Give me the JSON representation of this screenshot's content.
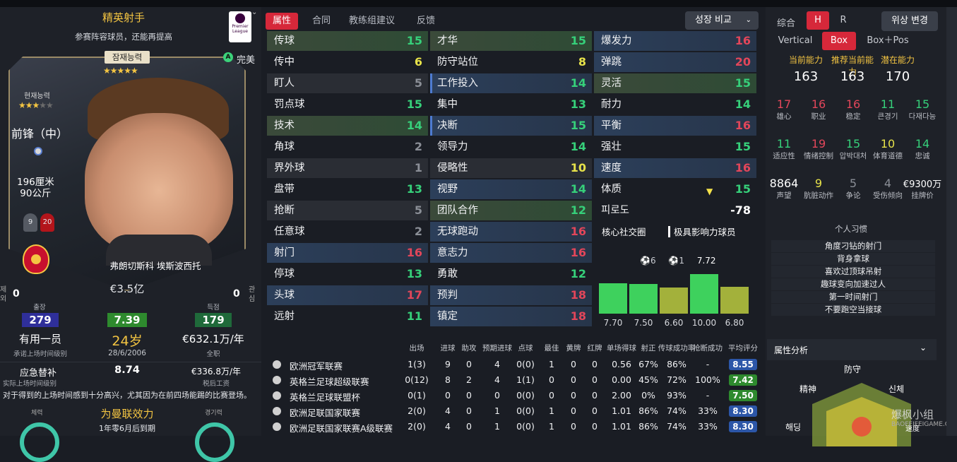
{
  "profile": {
    "role_title": "精英射手",
    "role_subtitle": "参赛阵容球员，还能再提高",
    "league_logo_text": "Premier League",
    "potential_label": "잠재능력",
    "potential_stars": "★★★★★",
    "perfect_icon": "A",
    "perfect_label": "完美",
    "current_label": "현재능력",
    "current_stars": "★★★",
    "current_stars_dim": "★★",
    "position": "前锋（中）",
    "height": "196厘米",
    "weight": "90公斤",
    "squad_number_left": "9",
    "squad_number_right": "20",
    "name": "弗朗切斯科 埃斯波西托",
    "value": "€3.5亿",
    "left_zero": "0",
    "left_zero_label": "제\n외",
    "right_zero": "0",
    "right_zero_label": "관\n심",
    "apps_label": "출장",
    "apps": "279",
    "rating_label": "",
    "rating": "7.39",
    "goals_label": "득점",
    "goals": "179",
    "status": "有用一员",
    "status_sub": "承诺上场时间级别",
    "age": "24岁",
    "dob": "28/6/2006",
    "wage": "€632.1万/年",
    "wage_sub": "全职",
    "squad_role": "应急替补",
    "squad_role_sub": "实际上场时间级别",
    "avg_rating": "8.74",
    "avg_rating_sub": "平均评分",
    "bonus": "€336.8万/年",
    "bonus_sub": "税后工资",
    "note": "对于得到的上场时间感到十分高兴，尤其因为在前四场能踢的比赛登场。",
    "condition_label": "체력",
    "contract_title": "为曼联效力",
    "contract_sub": "1年零6月后到期",
    "sharpness_label": "경기력"
  },
  "tabs": [
    {
      "label": "属性",
      "active": true
    },
    {
      "label": "合同"
    },
    {
      "label": "教练组建议"
    },
    {
      "label": "反馈"
    }
  ],
  "compare": {
    "label": "성장 비교",
    "chevron": "⌄"
  },
  "attributes": {
    "col1": [
      {
        "name": "传球",
        "value": "15",
        "cls": "v-green"
      },
      {
        "name": "传中",
        "value": "6",
        "cls": "v-yellow"
      },
      {
        "name": "盯人",
        "value": "5",
        "cls": "v-gray"
      },
      {
        "name": "罚点球",
        "value": "15",
        "cls": "v-green"
      },
      {
        "name": "技术",
        "value": "14",
        "cls": "v-green"
      },
      {
        "name": "角球",
        "value": "2",
        "cls": "v-gray"
      },
      {
        "name": "界外球",
        "value": "1",
        "cls": "v-gray"
      },
      {
        "name": "盘带",
        "value": "13",
        "cls": "v-green"
      },
      {
        "name": "抢断",
        "value": "5",
        "cls": "v-gray"
      },
      {
        "name": "任意球",
        "value": "2",
        "cls": "v-gray"
      },
      {
        "name": "射门",
        "value": "16",
        "cls": "v-red"
      },
      {
        "name": "停球",
        "value": "13",
        "cls": "v-green"
      },
      {
        "name": "头球",
        "value": "17",
        "cls": "v-red"
      },
      {
        "name": "远射",
        "value": "11",
        "cls": "v-green"
      }
    ],
    "col2": [
      {
        "name": "才华",
        "value": "15",
        "cls": "v-green"
      },
      {
        "name": "防守站位",
        "value": "8",
        "cls": "v-yellow"
      },
      {
        "name": "工作投入",
        "value": "14",
        "cls": "v-green"
      },
      {
        "name": "集中",
        "value": "13",
        "cls": "v-green"
      },
      {
        "name": "决断",
        "value": "15",
        "cls": "v-green"
      },
      {
        "name": "领导力",
        "value": "14",
        "cls": "v-green"
      },
      {
        "name": "侵略性",
        "value": "10",
        "cls": "v-yellow"
      },
      {
        "name": "视野",
        "value": "14",
        "cls": "v-green"
      },
      {
        "name": "团队合作",
        "value": "12",
        "cls": "v-green"
      },
      {
        "name": "无球跑动",
        "value": "16",
        "cls": "v-red"
      },
      {
        "name": "意志力",
        "value": "16",
        "cls": "v-red"
      },
      {
        "name": "勇敢",
        "value": "12",
        "cls": "v-green"
      },
      {
        "name": "预判",
        "value": "18",
        "cls": "v-red"
      },
      {
        "name": "镇定",
        "value": "18",
        "cls": "v-red"
      }
    ],
    "col3": [
      {
        "name": "爆发力",
        "value": "16",
        "cls": "v-red"
      },
      {
        "name": "弹跳",
        "value": "20",
        "cls": "v-red"
      },
      {
        "name": "灵活",
        "value": "15",
        "cls": "v-green"
      },
      {
        "name": "耐力",
        "value": "14",
        "cls": "v-green"
      },
      {
        "name": "平衡",
        "value": "16",
        "cls": "v-red"
      },
      {
        "name": "强壮",
        "value": "15",
        "cls": "v-green"
      },
      {
        "name": "速度",
        "value": "16",
        "cls": "v-red"
      },
      {
        "name": "体质",
        "value": "15",
        "cls": "v-green"
      },
      {
        "name": "피로도",
        "value": "-78",
        "cls": "v-white"
      }
    ],
    "decline_icon": "▼",
    "hub_label": "核心社交圈",
    "hub2_label": "极具影响力球员"
  },
  "form_chart": {
    "top_left": "6",
    "top_mid": "1",
    "top_value": "7.72"
  },
  "chart_data": {
    "type": "bar",
    "categories": [
      "1",
      "2",
      "3",
      "4",
      "5"
    ],
    "values": [
      7.7,
      7.5,
      6.6,
      10.0,
      6.8
    ],
    "value_labels": [
      "7.70",
      "7.50",
      "6.60",
      "10.00",
      "6.80"
    ],
    "colors": [
      "#3ed15d",
      "#3ed15d",
      "#a3b13b",
      "#3ed15d",
      "#a3b13b"
    ],
    "ylim": [
      0,
      10
    ]
  },
  "stats": {
    "headers": [
      "出场",
      "进球",
      "助攻",
      "预期进球",
      "点球",
      "最佳",
      "黄牌",
      "红牌",
      "单场得球",
      "射正",
      "传球成功率",
      "抢断成功",
      "平均评分"
    ],
    "rows": [
      {
        "comp": "欧洲冠军联赛",
        "vals": [
          "1(3)",
          "9",
          "0",
          "4",
          "0(0)",
          "1",
          "0",
          "0",
          "0.56",
          "67%",
          "86%",
          "-"
        ],
        "rating": "8.55",
        "rc": "#2c56a8"
      },
      {
        "comp": "英格兰足球超级联赛",
        "vals": [
          "0(12)",
          "8",
          "2",
          "4",
          "1(1)",
          "0",
          "0",
          "0",
          "0.00",
          "45%",
          "72%",
          "100%"
        ],
        "rating": "7.42",
        "rc": "#2e8a2e"
      },
      {
        "comp": "英格兰足球联盟杯",
        "vals": [
          "0(1)",
          "0",
          "0",
          "0",
          "0(0)",
          "0",
          "0",
          "0",
          "2.00",
          "0%",
          "93%",
          "-"
        ],
        "rating": "7.50",
        "rc": "#2e8a2e"
      },
      {
        "comp": "欧洲足联国家联赛",
        "vals": [
          "2(0)",
          "4",
          "0",
          "1",
          "0(0)",
          "1",
          "0",
          "0",
          "1.01",
          "86%",
          "74%",
          "33%"
        ],
        "rating": "8.30",
        "rc": "#2c56a8"
      },
      {
        "comp": "欧洲足联国家联赛A级联赛",
        "vals": [
          "2(0)",
          "4",
          "0",
          "1",
          "0(0)",
          "1",
          "0",
          "0",
          "1.01",
          "86%",
          "74%",
          "33%"
        ],
        "rating": "8.30",
        "rc": "#2c56a8"
      }
    ]
  },
  "right": {
    "overall_label": "综合",
    "h": "H",
    "r": "R",
    "change_label": "위상 변경",
    "vertical": "Vertical",
    "box": "Box",
    "boxpos": "Box＋Pos",
    "ability_headers": [
      "当前能力",
      "推荐当前能力",
      "潜在能力"
    ],
    "ability_values": [
      "163",
      "163",
      "170"
    ],
    "personal": [
      {
        "n": "17",
        "l": "雄心",
        "c": "#e2465a"
      },
      {
        "n": "16",
        "l": "职业",
        "c": "#e2465a"
      },
      {
        "n": "16",
        "l": "稳定",
        "c": "#e2465a"
      },
      {
        "n": "11",
        "l": "큰경기",
        "c": "#36d07a"
      },
      {
        "n": "15",
        "l": "다재다능",
        "c": "#36d07a"
      },
      {
        "n": "11",
        "l": "适应性",
        "c": "#36d07a"
      },
      {
        "n": "19",
        "l": "情绪控制",
        "c": "#e2465a"
      },
      {
        "n": "15",
        "l": "압박대처",
        "c": "#36d07a"
      },
      {
        "n": "10",
        "l": "体育道德",
        "c": "#e7e24a"
      },
      {
        "n": "14",
        "l": "忠诚",
        "c": "#36d07a"
      },
      {
        "n": "8864",
        "l": "声望",
        "c": "#ffffff"
      },
      {
        "n": "9",
        "l": "肮脏动作",
        "c": "#e7e24a"
      },
      {
        "n": "5",
        "l": "争论",
        "c": "#8b8f97"
      },
      {
        "n": "4",
        "l": "受伤倾向",
        "c": "#8b8f97"
      },
      {
        "n": "€9300万",
        "l": "挂牌价",
        "c": "#ffffff"
      }
    ],
    "habits_title": "个人习惯",
    "habits": [
      "角度刁钻的射门",
      "背身拿球",
      "喜欢过顶球吊射",
      "趣球变向加速过人",
      "第一时间射门",
      "不要跑空当接球"
    ],
    "attr_analysis": "属性分析",
    "radar_labels": {
      "top": "防守",
      "left": "精神",
      "right": "신체",
      "bl": "해딩",
      "br": "速度"
    },
    "watermark": "爆枫小组",
    "watermark_sub": "BAOFEIFEIGAME.CC"
  }
}
